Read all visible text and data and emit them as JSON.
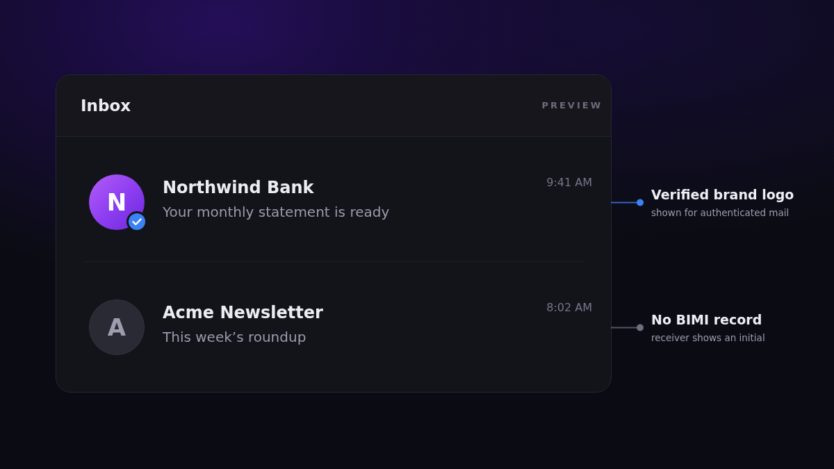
{
  "inbox": {
    "title": "Inbox",
    "mode_label": "PREVIEW"
  },
  "messages": [
    {
      "sender": "Northwind Bank",
      "subject": "Your monthly statement is ready",
      "time": "9:41 AM",
      "avatar": {
        "initial": "N",
        "kind": "brand"
      },
      "verified": true,
      "callout": {
        "title": "Verified brand logo",
        "note": "shown for authenticated mail",
        "color": "#3b82f6"
      }
    },
    {
      "sender": "Acme Newsletter",
      "subject": "This week’s roundup",
      "time": "8:02 AM",
      "avatar": {
        "initial": "A",
        "kind": "initial"
      },
      "verified": false,
      "callout": {
        "title": "No BIMI record",
        "note": "receiver shows an initial",
        "color": "#6e6e7e"
      }
    }
  ]
}
